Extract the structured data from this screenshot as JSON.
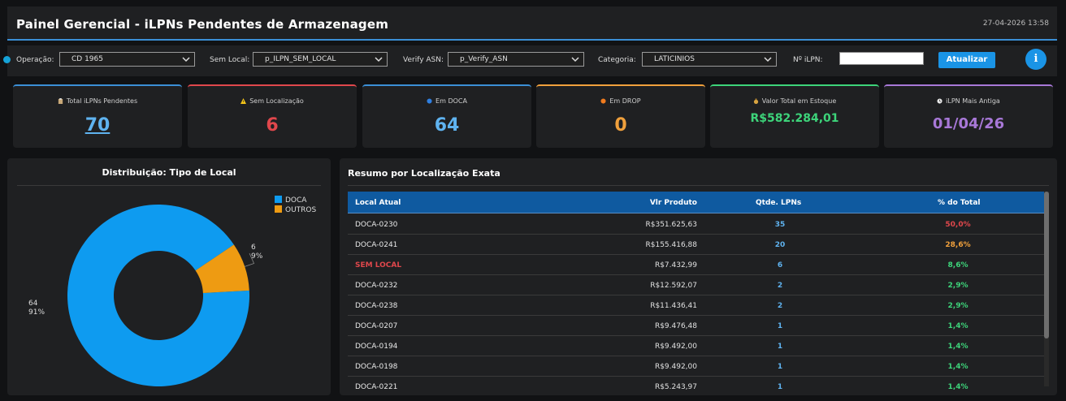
{
  "header": {
    "title": "Painel Gerencial - iLPNs Pendentes de Armazenagem",
    "date": "27-04-2026 13:58"
  },
  "filters": {
    "operacao_label": "Operação:",
    "operacao_value": "CD 1965",
    "sem_local_label": "Sem Local:",
    "sem_local_value": "p_ILPN_SEM_LOCAL",
    "verify_label": "Verify ASN:",
    "verify_value": "p_Verify_ASN",
    "categoria_label": "Categoria:",
    "categoria_value": "LATICINIOS",
    "ilpn_label": "Nº iLPN:",
    "ilpn_value": "",
    "update_label": "Atualizar",
    "info_label": "i"
  },
  "colors": {
    "blue": "#3b8fd6",
    "red": "#e0474c",
    "orange": "#f0a03c",
    "green": "#3dd47a",
    "purple": "#a878d8",
    "accent": "#1a94e6"
  },
  "kpis": [
    {
      "icon": "clipboard-icon",
      "label": "Total iLPNs Pendentes",
      "value": "70"
    },
    {
      "icon": "warning-icon",
      "label": "Sem Localização",
      "value": "6"
    },
    {
      "icon": "blue-circle-icon",
      "label": "Em DOCA",
      "value": "64"
    },
    {
      "icon": "orange-circle-icon",
      "label": "Em DROP",
      "value": "0"
    },
    {
      "icon": "money-bag-icon",
      "label": "Valor Total em Estoque",
      "value": "R$582.284,01"
    },
    {
      "icon": "clock-icon",
      "label": "iLPN Mais Antiga",
      "value": "01/04/26"
    }
  ],
  "chart": {
    "title": "Distribuição: Tipo de Local"
  },
  "chart_data": {
    "type": "pie",
    "title": "Distribuição: Tipo de Local",
    "categories": [
      "DOCA",
      "OUTROS"
    ],
    "values": [
      64,
      6
    ],
    "percent_labels": [
      "91%",
      "9%"
    ],
    "colors": [
      "#0e9bf0",
      "#ee9b12"
    ],
    "donut": true,
    "legend": "top-right"
  },
  "table": {
    "title": "Resumo por Localização Exata",
    "headers": [
      "Local Atual",
      "Vlr Produto",
      "Qtde. LPNs",
      "% do Total"
    ],
    "rows": [
      {
        "loc": "DOCA-0230",
        "vlr": "R$351.625,63",
        "qty": "35",
        "pct": "50,0%"
      },
      {
        "loc": "DOCA-0241",
        "vlr": "R$155.416,88",
        "qty": "20",
        "pct": "28,6%"
      },
      {
        "loc": "SEM LOCAL",
        "vlr": "R$7.432,99",
        "qty": "6",
        "pct": "8,6%"
      },
      {
        "loc": "DOCA-0232",
        "vlr": "R$12.592,07",
        "qty": "2",
        "pct": "2,9%"
      },
      {
        "loc": "DOCA-0238",
        "vlr": "R$11.436,41",
        "qty": "2",
        "pct": "2,9%"
      },
      {
        "loc": "DOCA-0207",
        "vlr": "R$9.476,48",
        "qty": "1",
        "pct": "1,4%"
      },
      {
        "loc": "DOCA-0194",
        "vlr": "R$9.492,00",
        "qty": "1",
        "pct": "1,4%"
      },
      {
        "loc": "DOCA-0198",
        "vlr": "R$9.492,00",
        "qty": "1",
        "pct": "1,4%"
      },
      {
        "loc": "DOCA-0221",
        "vlr": "R$5.243,97",
        "qty": "1",
        "pct": "1,4%"
      }
    ]
  }
}
